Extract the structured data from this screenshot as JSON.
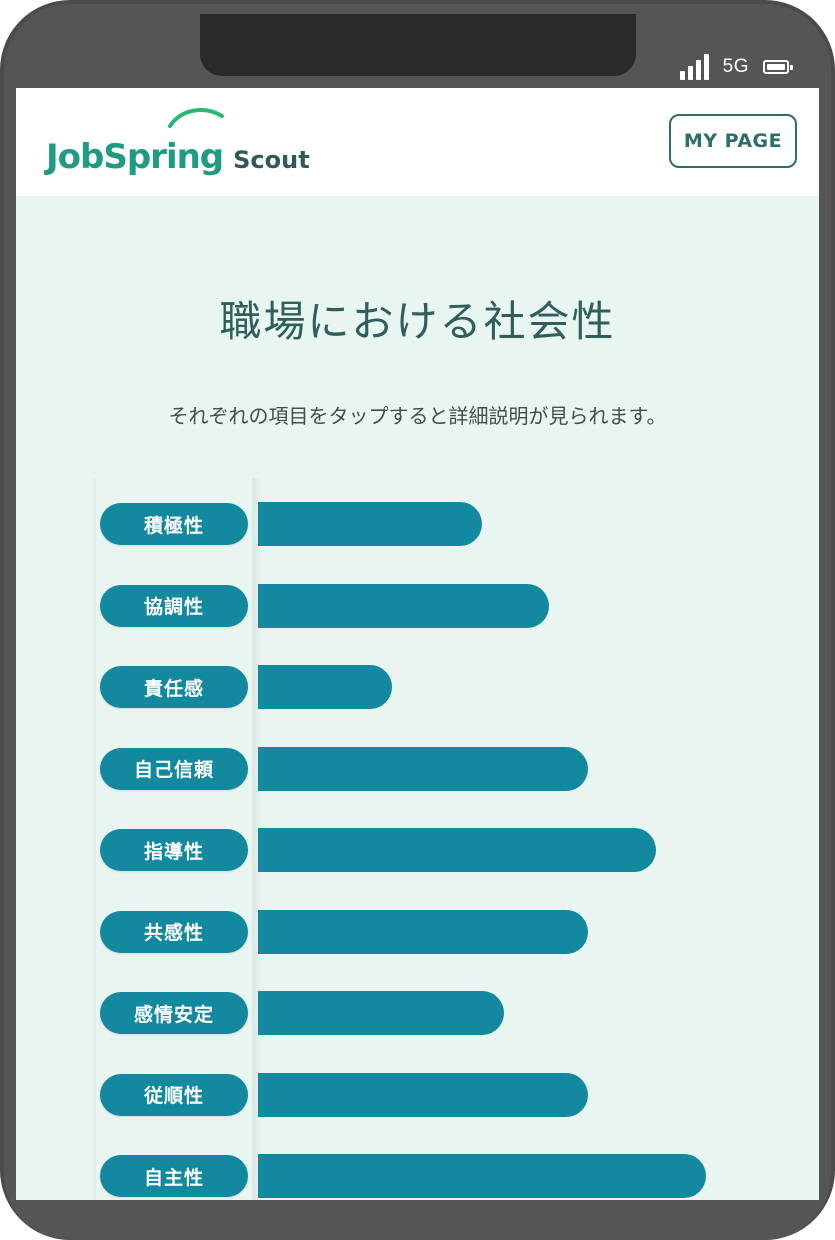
{
  "status": {
    "network": "5G"
  },
  "header": {
    "logo_main": "JobSpring",
    "logo_sub": "Scout",
    "mypage_label": "MY PAGE"
  },
  "page": {
    "title": "職場における社会性",
    "subtitle": "それぞれの項目をタップすると詳細説明が見られます。"
  },
  "colors": {
    "bar": "#12899f",
    "brand": "#1f9b83",
    "accent": "#2c6e6a",
    "background": "#e8f5f0"
  },
  "chart_data": {
    "type": "bar",
    "orientation": "horizontal",
    "categories": [
      "積極性",
      "協調性",
      "責任感",
      "自己信頼",
      "指導性",
      "共感性",
      "感情安定",
      "従順性",
      "自主性"
    ],
    "values": [
      0.4,
      0.52,
      0.24,
      0.59,
      0.71,
      0.59,
      0.44,
      0.59,
      0.8
    ]
  }
}
